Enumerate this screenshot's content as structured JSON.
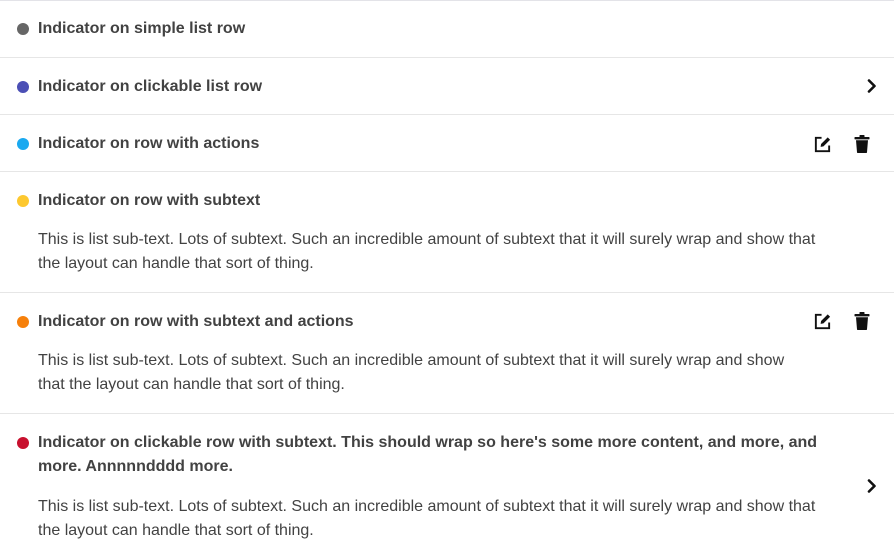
{
  "list": {
    "items": [
      {
        "title": "Indicator on simple list row",
        "indicator_color": "#666666"
      },
      {
        "title": "Indicator on clickable list row",
        "indicator_color": "#4b4fb5",
        "clickable": true,
        "chevron_icon": "chevron-right-icon"
      },
      {
        "title": "Indicator on row with actions",
        "indicator_color": "#1aa9f0",
        "actions": [
          "edit-icon",
          "trash-icon"
        ]
      },
      {
        "title": "Indicator on row with subtext",
        "indicator_color": "#fdc82f",
        "subtext": "This is list sub-text. Lots of subtext. Such an incredible amount of subtext that it will surely wrap and show that the layout can handle that sort of thing."
      },
      {
        "title": "Indicator on row with subtext and actions",
        "indicator_color": "#f6800b",
        "subtext": "This is list sub-text. Lots of subtext. Such an incredible amount of subtext that it will surely wrap and show that the layout can handle that sort of thing.",
        "actions": [
          "edit-icon",
          "trash-icon"
        ]
      },
      {
        "title": "Indicator on clickable row with subtext. This should wrap so here's some more content, and more, and more. Annnnndddd more.",
        "indicator_color": "#c8102e",
        "subtext": "This is list sub-text. Lots of subtext. Such an incredible amount of subtext that it will surely wrap and show that the layout can handle that sort of thing.",
        "clickable": true,
        "chevron_icon": "chevron-right-icon"
      }
    ]
  }
}
